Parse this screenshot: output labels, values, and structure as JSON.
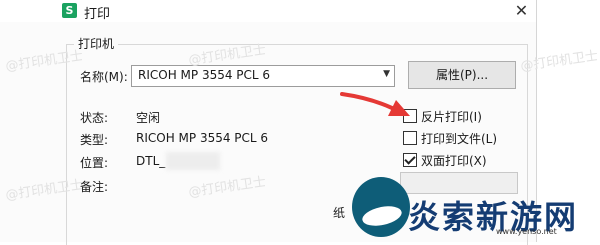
{
  "window": {
    "title": "打印",
    "app_icon_letter": "S",
    "close_symbol": "✕"
  },
  "printer_group": {
    "title": "打印机",
    "name_label": "名称(M):",
    "printer_name": "RICOH MP 3554 PCL 6",
    "properties_button": "属性(P)...",
    "status_label": "状态:",
    "status_value": "空闲",
    "type_label": "类型:",
    "type_value": "RICOH MP 3554 PCL 6",
    "location_label": "位置:",
    "location_value": "DTL_",
    "comment_label": "备注:",
    "paper_label_partial": "纸"
  },
  "options": [
    {
      "label": "反片打印(I)",
      "checked": false
    },
    {
      "label": "打印到文件(L)",
      "checked": false
    },
    {
      "label": "双面打印(X)",
      "checked": true
    }
  ],
  "watermark": "@打印机卫士",
  "branding": {
    "logo_text": "炎索新游网",
    "url": "www.yenso.net"
  },
  "colors": {
    "accent_arrow": "#e53935",
    "app_icon": "#1aa260",
    "brand_text": "#143c73"
  }
}
